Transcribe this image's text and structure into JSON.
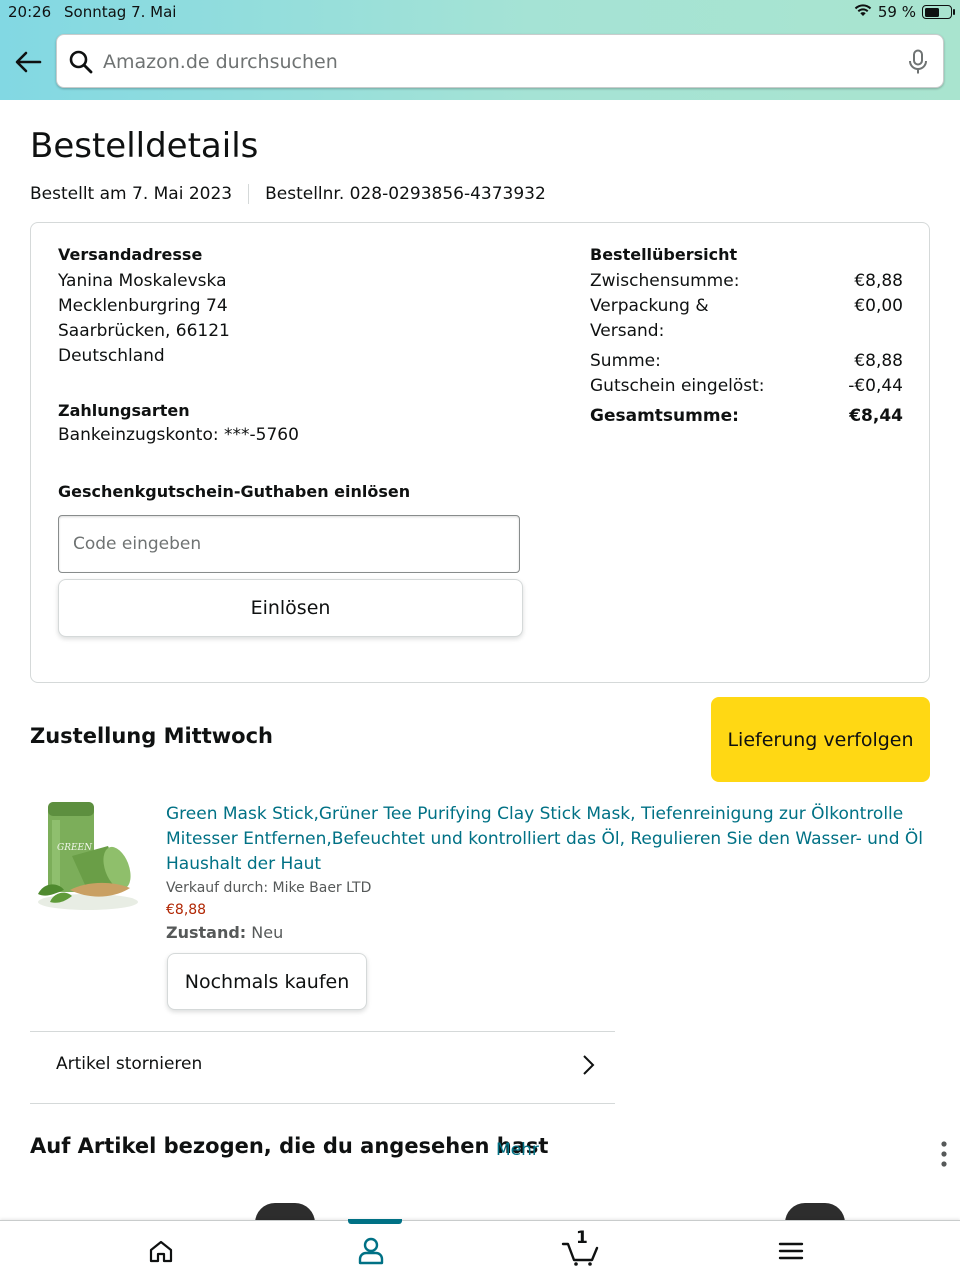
{
  "status_bar": {
    "time": "20:26",
    "date": "Sonntag 7. Mai",
    "battery": "59 %",
    "battery_level": 0.59
  },
  "header": {
    "search_placeholder": "Amazon.de durchsuchen"
  },
  "page": {
    "title": "Bestelldetails",
    "ordered_on": "Bestellt am 7. Mai 2023",
    "order_number": "Bestellnr. 028-0293856-4373932"
  },
  "shipping": {
    "heading": "Versandadresse",
    "lines": [
      "Yanina Moskalevska",
      "Mecklenburgring 74",
      "Saarbrücken, 66121",
      "Deutschland"
    ]
  },
  "payment": {
    "heading": "Zahlungsarten",
    "method": "Bankeinzugskonto: ***-5760"
  },
  "gift_card": {
    "heading": "Geschenkgutschein-Guthaben einlösen",
    "placeholder": "Code eingeben",
    "button": "Einlösen"
  },
  "summary": {
    "heading": "Bestellübersicht",
    "rows": [
      {
        "label": "Zwischensumme:",
        "value": "€8,88"
      },
      {
        "label": "Verpackung & Versand:",
        "value": "€0,00"
      },
      {
        "label": "Summe:",
        "value": "€8,88"
      },
      {
        "label": "Gutschein eingelöst:",
        "value": "-€0,44"
      }
    ],
    "total_label": "Gesamtsumme:",
    "total_value": "€8,44"
  },
  "delivery": {
    "heading": "Zustellung Mittwoch",
    "track_button": "Lieferung verfolgen"
  },
  "product": {
    "title": "Green Mask Stick,Grüner Tee Purifying Clay Stick Mask, Tiefenreinigung zur Ölkontrolle Mitesser Entfernen,Befeuchtet und kontrolliert das Öl, Regulieren Sie den Wasser- und Öl Haushalt der Haut",
    "seller": "Verkauf durch: Mike Baer LTD",
    "price": "€8,88",
    "condition_label": "Zustand:",
    "condition_value": "Neu",
    "buy_again": "Nochmals kaufen",
    "image_text": "GREEN"
  },
  "cancel": {
    "label": "Artikel stornieren"
  },
  "related": {
    "heading": "Auf Artikel bezogen, die du angesehen hast",
    "more": "Mehr"
  },
  "bottom_nav": {
    "items": [
      "home-icon",
      "account-icon",
      "cart-icon",
      "menu-icon"
    ],
    "cart_count": "1",
    "active_color": "#007185"
  },
  "colors": {
    "link": "#007185",
    "price": "#b12704",
    "track_button": "#ffd814"
  }
}
